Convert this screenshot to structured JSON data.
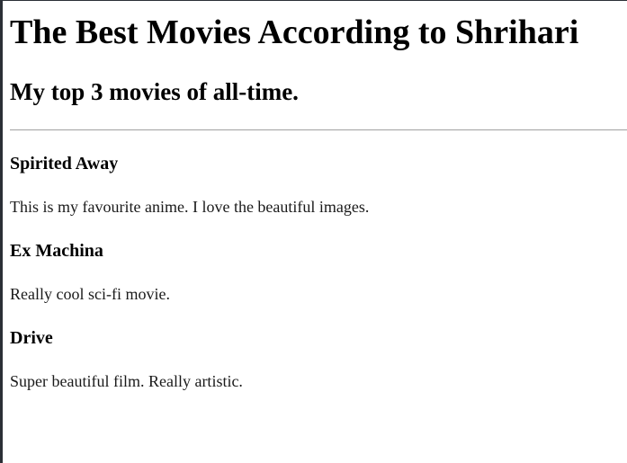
{
  "page": {
    "heading": "The Best Movies According to Shrihari",
    "subheading": "My top 3 movies of all-time."
  },
  "movies": [
    {
      "title": "Spirited Away",
      "description": "This is my favourite anime. I love the beautiful images."
    },
    {
      "title": "Ex Machina",
      "description": "Really cool sci-fi movie."
    },
    {
      "title": "Drive",
      "description": "Super beautiful film. Really artistic."
    }
  ],
  "colors": {
    "background": "#ffffff",
    "text": "#000000",
    "rule": "#a0a0a0",
    "frame": "#2b2f36"
  }
}
